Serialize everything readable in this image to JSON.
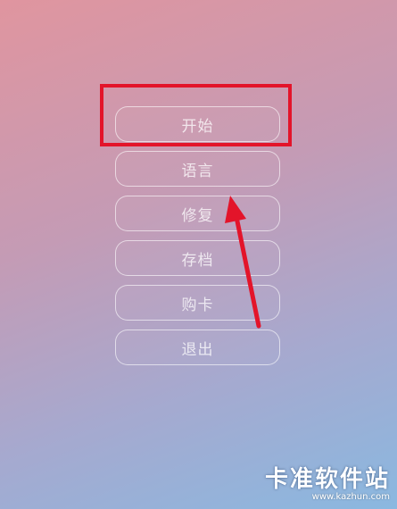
{
  "menu": {
    "items": [
      {
        "label": "开始"
      },
      {
        "label": "语言"
      },
      {
        "label": "修复"
      },
      {
        "label": "存档"
      },
      {
        "label": "购卡"
      },
      {
        "label": "退出"
      }
    ]
  },
  "annotation": {
    "highlight_color": "#e3142a"
  },
  "watermark": {
    "title": "卡准软件站",
    "url": "www.kazhun.com"
  }
}
